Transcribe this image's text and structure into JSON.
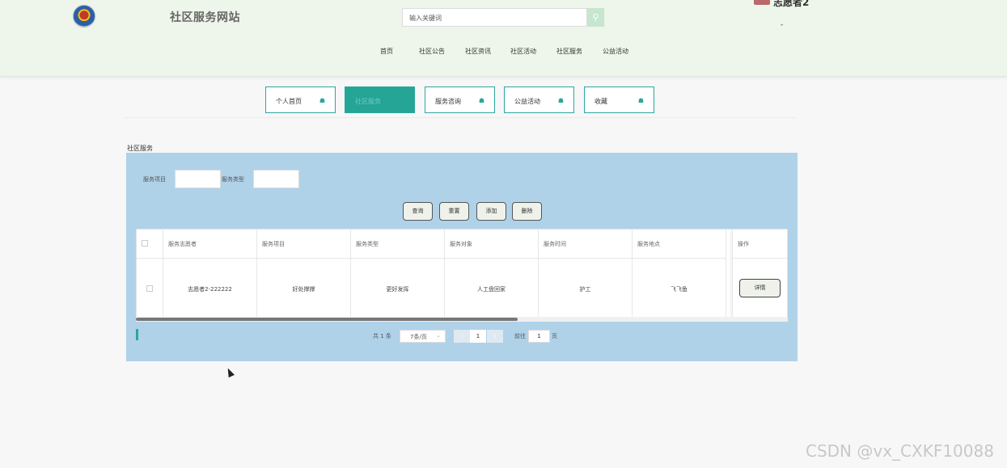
{
  "header": {
    "site_title": "社区服务网站",
    "search_placeholder": "输入关键词",
    "search_icon": "search-icon",
    "username": "志愿者2",
    "user_sub": "-",
    "nav": [
      "首页",
      "社区公告",
      "社区资讯",
      "社区活动",
      "社区服务",
      "公益活动"
    ]
  },
  "sub_tabs": [
    {
      "label": "个人首页",
      "active": false
    },
    {
      "label": "社区服务",
      "active": true
    },
    {
      "label": "服务咨询",
      "active": false
    },
    {
      "label": "公益活动",
      "active": false
    },
    {
      "label": "收藏",
      "active": false
    }
  ],
  "section_title": "社区服务",
  "filters": {
    "service_item_label": "服务项目",
    "service_type_label": "服务类型",
    "service_item_value": "",
    "service_type_value": ""
  },
  "buttons": {
    "query": "查询",
    "reset": "重置",
    "add": "添加",
    "delete": "删除"
  },
  "table": {
    "columns": [
      "服务志愿者",
      "服务项目",
      "服务类型",
      "服务对象",
      "服务时间",
      "服务地点",
      "操作"
    ],
    "rows": [
      {
        "volunteer": "志愿者2-222222",
        "item": "好处撑撑",
        "type": "更好发挥",
        "target": "人工盘回家",
        "time": "护工",
        "place": "飞飞鱼",
        "action": "详情"
      }
    ]
  },
  "pagination": {
    "total": "共 1 条",
    "page_size": "7条/页",
    "prev": "‹",
    "current": "1",
    "next": "›",
    "goto_label": "前往",
    "goto_value": "1",
    "goto_suffix": "页"
  },
  "watermark": "CSDN @vx_CXKF10088",
  "colors": {
    "accent": "#24a596",
    "panel": "#afd2e9",
    "header_bg": "#eef5ea"
  }
}
